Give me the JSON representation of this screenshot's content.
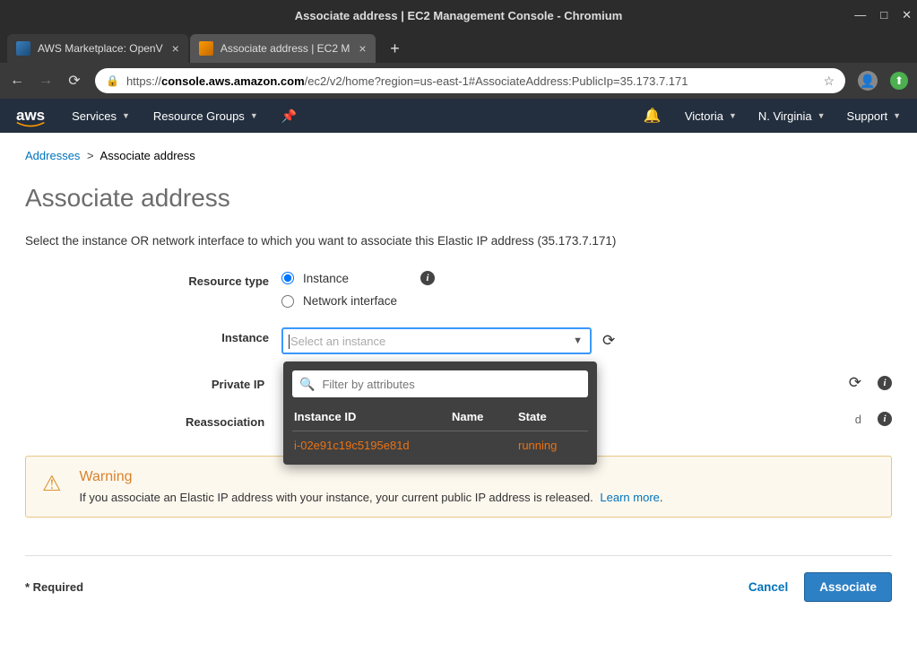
{
  "window": {
    "title": "Associate address | EC2 Management Console - Chromium"
  },
  "tabs": [
    {
      "title": "AWS Marketplace: OpenV"
    },
    {
      "title": "Associate address | EC2 M"
    }
  ],
  "url": {
    "host": "console.aws.amazon.com",
    "path": "/ec2/v2/home?region=us-east-1#AssociateAddress:PublicIp=35.173.7.171"
  },
  "aws_header": {
    "logo": "aws",
    "services": "Services",
    "resource_groups": "Resource Groups",
    "user": "Victoria",
    "region": "N. Virginia",
    "support": "Support"
  },
  "breadcrumb": {
    "addresses": "Addresses",
    "current": "Associate address"
  },
  "page": {
    "title": "Associate address",
    "instruction": "Select the instance OR network interface to which you want to associate this Elastic IP address (35.173.7.171)"
  },
  "form": {
    "resource_type_label": "Resource type",
    "resource_type_options": {
      "instance": "Instance",
      "ni": "Network interface"
    },
    "instance_label": "Instance",
    "instance_placeholder": "Select an instance",
    "private_ip_label": "Private IP",
    "reassociation_label": "Reassociation"
  },
  "dropdown": {
    "filter_placeholder": "Filter by attributes",
    "cols": {
      "id": "Instance ID",
      "name": "Name",
      "state": "State"
    },
    "rows": [
      {
        "id": "i-02e91c19c5195e81d",
        "name": "",
        "state": "running"
      }
    ]
  },
  "warning": {
    "title": "Warning",
    "text": "If you associate an Elastic IP address with your instance, your current public IP address is released.",
    "learn_more": "Learn more"
  },
  "footer": {
    "required": "* Required",
    "cancel": "Cancel",
    "associate": "Associate"
  }
}
